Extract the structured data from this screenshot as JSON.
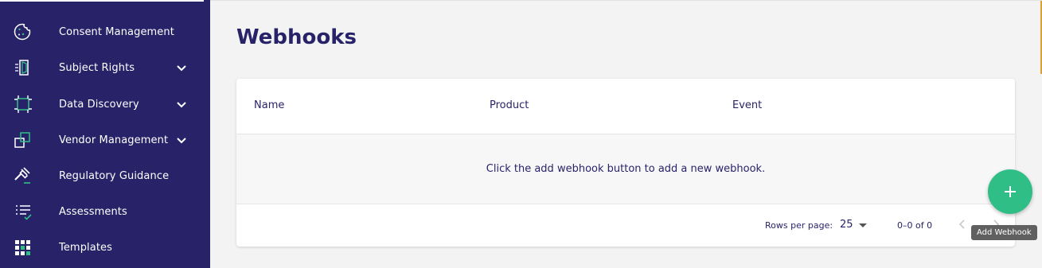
{
  "sidebar": {
    "items": [
      {
        "label": "Consent Management",
        "icon": "cookie-icon",
        "expandable": false
      },
      {
        "label": "Subject Rights",
        "icon": "door-icon",
        "expandable": true
      },
      {
        "label": "Data Discovery",
        "icon": "scan-frame-icon",
        "expandable": true
      },
      {
        "label": "Vendor Management",
        "icon": "overlapping-squares-icon",
        "expandable": true
      },
      {
        "label": "Regulatory Guidance",
        "icon": "gavel-icon",
        "expandable": false
      },
      {
        "label": "Assessments",
        "icon": "checklist-icon",
        "expandable": false
      },
      {
        "label": "Templates",
        "icon": "grid-icon",
        "expandable": false
      }
    ]
  },
  "main": {
    "title": "Webhooks",
    "table": {
      "columns": [
        "Name",
        "Product",
        "Event"
      ],
      "empty_message": "Click the add webhook button to add a new webhook."
    },
    "pagination": {
      "rows_per_page_label": "Rows per page:",
      "rows_per_page_value": "25",
      "range_text": "0–0 of 0"
    }
  },
  "fab": {
    "icon": "plus-icon",
    "tooltip": "Add Webhook"
  },
  "colors": {
    "sidebar_bg": "#282368",
    "accent_green": "#2fbf86",
    "title_text": "#282368"
  }
}
